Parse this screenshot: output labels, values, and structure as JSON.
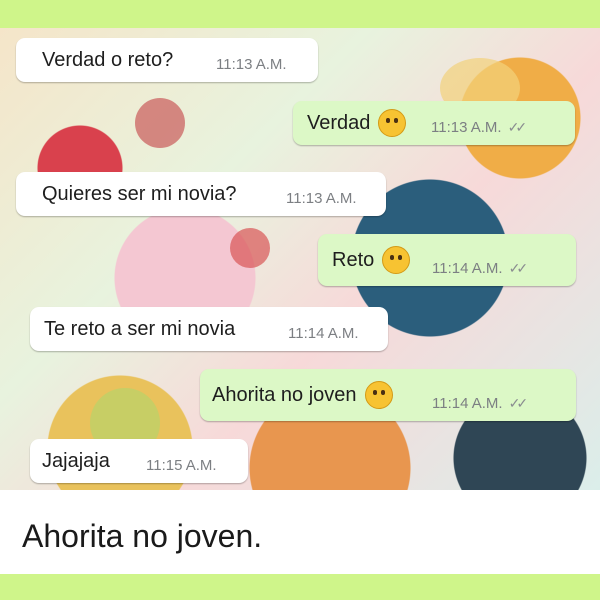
{
  "messages": [
    {
      "dir": "in",
      "text": "Verdad o reto?",
      "time": "11:13 A.M."
    },
    {
      "dir": "out",
      "text": "Verdad",
      "emoji": "thinking-face-icon",
      "time": "11:13 A.M."
    },
    {
      "dir": "in",
      "text": "Quieres ser mi novia?",
      "time": "11:13 A.M."
    },
    {
      "dir": "out",
      "text": "Reto",
      "emoji": "grinning-sweat-face-icon",
      "time": "11:14 A.M."
    },
    {
      "dir": "in",
      "text": "Te reto a ser mi novia",
      "time": "11:14 A.M."
    },
    {
      "dir": "out",
      "text": "Ahorita no joven",
      "emoji": "rolling-laughing-face-icon",
      "time": "11:14 A.M."
    },
    {
      "dir": "in",
      "text": "Jajajaja",
      "time": "11:15 A.M."
    }
  ],
  "ticks": "✓✓",
  "caption": "Ahorita no joven.",
  "colors": {
    "incoming": "#ffffff",
    "outgoing": "#dcf8c6",
    "frame": "#cff58a",
    "timestamp": "#7c7f83"
  }
}
